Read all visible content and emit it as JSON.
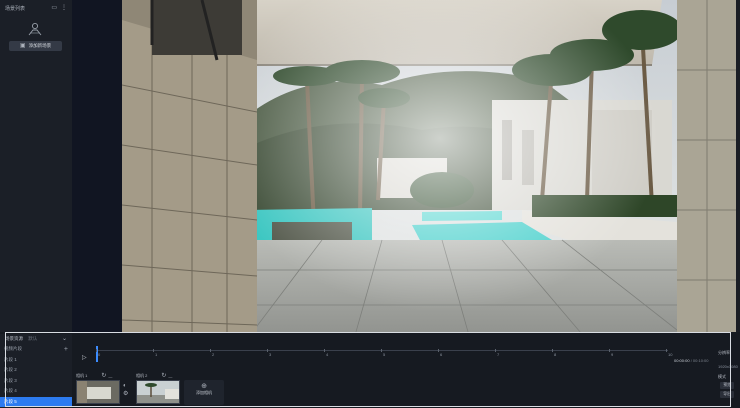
{
  "sidebar": {
    "title": "场景列表",
    "add_scene_label": "添加新场景"
  },
  "bottom": {
    "panel_title": "场景资源",
    "panel_subtitle": "默认",
    "section_label": "视频片段",
    "items": [
      {
        "label": "片段 1"
      },
      {
        "label": "片段 2"
      },
      {
        "label": "片段 3"
      },
      {
        "label": "片段 4"
      },
      {
        "label": "片段 5",
        "active": true
      }
    ],
    "ruler": [
      "0",
      "1",
      "2",
      "3",
      "4",
      "5",
      "6",
      "7",
      "8",
      "9",
      "10"
    ],
    "time_current": "00:00:00",
    "time_total": "/ 00:10:00",
    "clips": [
      {
        "label": "相机 1"
      },
      {
        "label": "相机 2"
      }
    ],
    "add_camera_label": "添加相机"
  },
  "right_panel": {
    "title": "分辨率",
    "resolution": "1920x1080",
    "mode_label": "模式",
    "btn1": "预览",
    "btn2": "导出"
  },
  "colors": {
    "accent": "#2d7bf0",
    "playhead": "#3c8cff"
  }
}
